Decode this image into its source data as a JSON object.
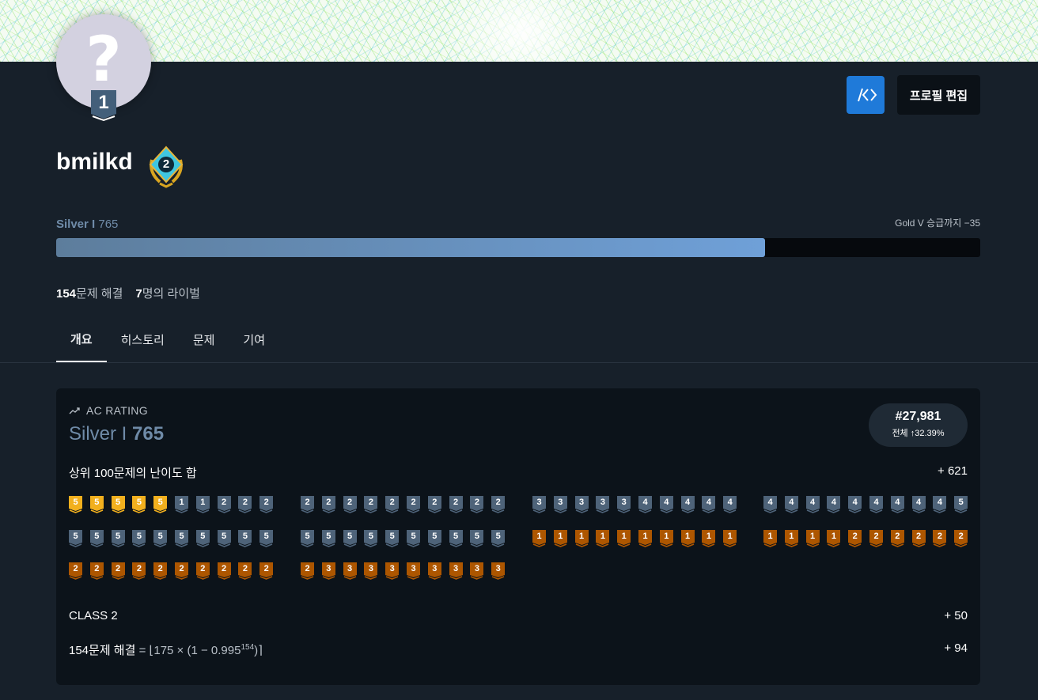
{
  "profile": {
    "username": "bmilkd",
    "avatar_glyph": "?",
    "tier_number": "1",
    "class_number": "2",
    "edit_button": "프로필 편집",
    "code_button_icon": "code-icon"
  },
  "progress": {
    "tier": "Silver I",
    "rating": "765",
    "promotion_text": "Gold V 승급까지 −35",
    "fill_percent": 76.7
  },
  "stats": {
    "solved_count": "154",
    "solved_label": "문제 해결",
    "rival_count": "7",
    "rival_label": "명의 라이벌"
  },
  "tabs": [
    {
      "label": "개요",
      "active": true
    },
    {
      "label": "히스토리",
      "active": false
    },
    {
      "label": "문제",
      "active": false
    },
    {
      "label": "기여",
      "active": false
    }
  ],
  "ac_rating": {
    "label": "AC RATING",
    "tier": "Silver I",
    "rating": "765",
    "rank": "#27,981",
    "rank_detail": "전체 ↑32.39%",
    "top100_label": "상위 100문제의 난이도 합",
    "top100_value": "+ 621",
    "class_label": "CLASS 2",
    "class_value": "+ 50",
    "solved_label": "154문제 해결",
    "formula_prefix": "= ⌊175 × (1 − 0.995",
    "formula_exp": "154",
    "formula_suffix": ")⌉",
    "solved_value": "+ 94"
  },
  "badge_colors": {
    "gold": "#f2b01e",
    "silver": "#4e6379",
    "bronze": "#ad5600"
  },
  "problem_badges": [
    [
      [
        [
          "gold",
          "5"
        ],
        [
          "gold",
          "5"
        ],
        [
          "gold",
          "5"
        ],
        [
          "gold",
          "5"
        ],
        [
          "gold",
          "5"
        ],
        [
          "silver",
          "1"
        ],
        [
          "silver",
          "1"
        ],
        [
          "silver",
          "2"
        ],
        [
          "silver",
          "2"
        ],
        [
          "silver",
          "2"
        ]
      ],
      [
        [
          "silver",
          "2"
        ],
        [
          "silver",
          "2"
        ],
        [
          "silver",
          "2"
        ],
        [
          "silver",
          "2"
        ],
        [
          "silver",
          "2"
        ],
        [
          "silver",
          "2"
        ],
        [
          "silver",
          "2"
        ],
        [
          "silver",
          "2"
        ],
        [
          "silver",
          "2"
        ],
        [
          "silver",
          "2"
        ]
      ],
      [
        [
          "silver",
          "3"
        ],
        [
          "silver",
          "3"
        ],
        [
          "silver",
          "3"
        ],
        [
          "silver",
          "3"
        ],
        [
          "silver",
          "3"
        ],
        [
          "silver",
          "4"
        ],
        [
          "silver",
          "4"
        ],
        [
          "silver",
          "4"
        ],
        [
          "silver",
          "4"
        ],
        [
          "silver",
          "4"
        ]
      ],
      [
        [
          "silver",
          "4"
        ],
        [
          "silver",
          "4"
        ],
        [
          "silver",
          "4"
        ],
        [
          "silver",
          "4"
        ],
        [
          "silver",
          "4"
        ],
        [
          "silver",
          "4"
        ],
        [
          "silver",
          "4"
        ],
        [
          "silver",
          "4"
        ],
        [
          "silver",
          "4"
        ],
        [
          "silver",
          "5"
        ]
      ]
    ],
    [
      [
        [
          "silver",
          "5"
        ],
        [
          "silver",
          "5"
        ],
        [
          "silver",
          "5"
        ],
        [
          "silver",
          "5"
        ],
        [
          "silver",
          "5"
        ],
        [
          "silver",
          "5"
        ],
        [
          "silver",
          "5"
        ],
        [
          "silver",
          "5"
        ],
        [
          "silver",
          "5"
        ],
        [
          "silver",
          "5"
        ]
      ],
      [
        [
          "silver",
          "5"
        ],
        [
          "silver",
          "5"
        ],
        [
          "silver",
          "5"
        ],
        [
          "silver",
          "5"
        ],
        [
          "silver",
          "5"
        ],
        [
          "silver",
          "5"
        ],
        [
          "silver",
          "5"
        ],
        [
          "silver",
          "5"
        ],
        [
          "silver",
          "5"
        ],
        [
          "silver",
          "5"
        ]
      ],
      [
        [
          "bronze",
          "1"
        ],
        [
          "bronze",
          "1"
        ],
        [
          "bronze",
          "1"
        ],
        [
          "bronze",
          "1"
        ],
        [
          "bronze",
          "1"
        ],
        [
          "bronze",
          "1"
        ],
        [
          "bronze",
          "1"
        ],
        [
          "bronze",
          "1"
        ],
        [
          "bronze",
          "1"
        ],
        [
          "bronze",
          "1"
        ]
      ],
      [
        [
          "bronze",
          "1"
        ],
        [
          "bronze",
          "1"
        ],
        [
          "bronze",
          "1"
        ],
        [
          "bronze",
          "1"
        ],
        [
          "bronze",
          "2"
        ],
        [
          "bronze",
          "2"
        ],
        [
          "bronze",
          "2"
        ],
        [
          "bronze",
          "2"
        ],
        [
          "bronze",
          "2"
        ],
        [
          "bronze",
          "2"
        ]
      ]
    ],
    [
      [
        [
          "bronze",
          "2"
        ],
        [
          "bronze",
          "2"
        ],
        [
          "bronze",
          "2"
        ],
        [
          "bronze",
          "2"
        ],
        [
          "bronze",
          "2"
        ],
        [
          "bronze",
          "2"
        ],
        [
          "bronze",
          "2"
        ],
        [
          "bronze",
          "2"
        ],
        [
          "bronze",
          "2"
        ],
        [
          "bronze",
          "2"
        ]
      ],
      [
        [
          "bronze",
          "2"
        ],
        [
          "bronze",
          "3"
        ],
        [
          "bronze",
          "3"
        ],
        [
          "bronze",
          "3"
        ],
        [
          "bronze",
          "3"
        ],
        [
          "bronze",
          "3"
        ],
        [
          "bronze",
          "3"
        ],
        [
          "bronze",
          "3"
        ],
        [
          "bronze",
          "3"
        ],
        [
          "bronze",
          "3"
        ]
      ]
    ]
  ]
}
